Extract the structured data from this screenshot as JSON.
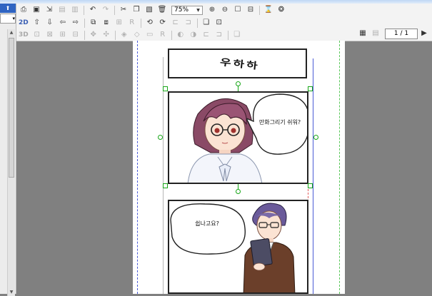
{
  "toolbar": {
    "zoom_value": "75%",
    "row2_label": "2D",
    "row3_label": "3D"
  },
  "navigator": {
    "page_indicator": "1 / 1"
  },
  "canvas": {
    "title_panel_text": "우하하",
    "panel1_speech": "만화그리기 쉬워?",
    "panel2_speech": "쉽나고요?"
  },
  "colors": {
    "selection": "#16a616",
    "guide_blue": "#4a5bd6",
    "guide_red": "#e35a5a",
    "guide_green": "#5ac85a"
  }
}
